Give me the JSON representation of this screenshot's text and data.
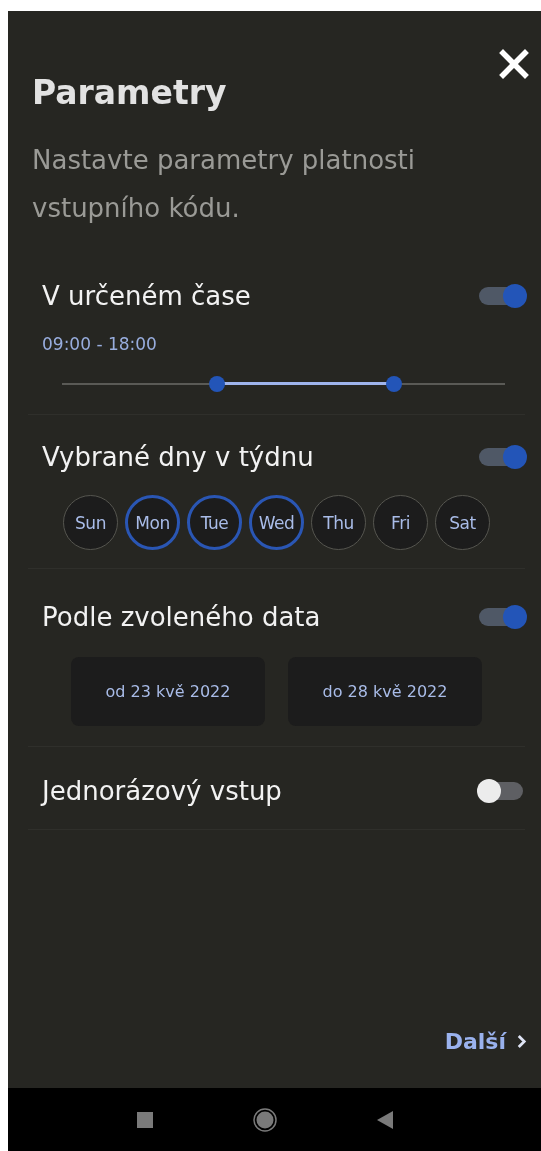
{
  "title": "Parametry",
  "subtitle": "Nastavte parametry platnosti vstupního kódu.",
  "sections": [
    {
      "kind": "time",
      "label": "V určeném čase",
      "on": true,
      "range_text": "09:00 - 18:00",
      "thumbs": [
        {
          "level": 0.35
        },
        {
          "level": 0.75
        }
      ]
    },
    {
      "kind": "days",
      "label": "Vybrané dny v týdnu",
      "on": true,
      "days": [
        {
          "label": "Sun",
          "selected": false
        },
        {
          "label": "Mon",
          "selected": true
        },
        {
          "label": "Tue",
          "selected": true
        },
        {
          "label": "Wed",
          "selected": true
        },
        {
          "label": "Thu",
          "selected": false
        },
        {
          "label": "Fri",
          "selected": false
        },
        {
          "label": "Sat",
          "selected": false
        }
      ]
    },
    {
      "kind": "dates",
      "label": "Podle zvoleného data",
      "on": true,
      "dates": [
        "od 23 kvě 2022",
        "do 28 kvě 2022"
      ]
    },
    {
      "kind": "plain",
      "label": "Jednorázový vstup",
      "on": false
    }
  ],
  "next_button": "Další"
}
